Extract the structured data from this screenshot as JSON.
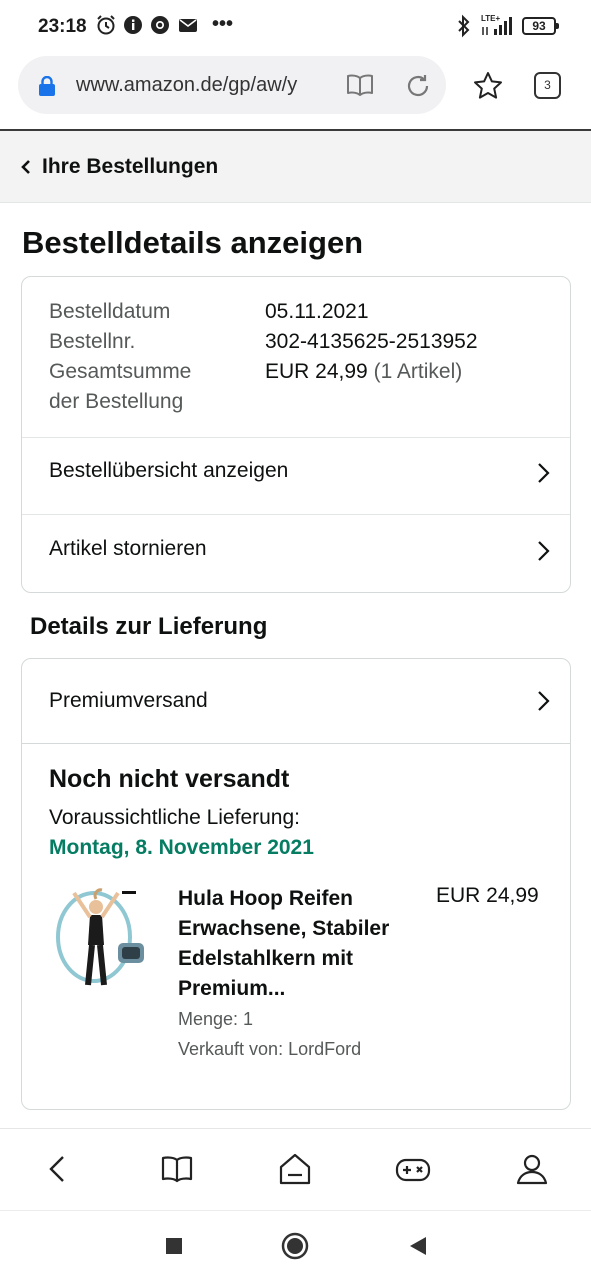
{
  "status_bar": {
    "time": "23:18",
    "more": "•••",
    "network": "LTE+",
    "battery": "93"
  },
  "browser": {
    "url": "www.amazon.de/gp/aw/y",
    "tab_count": "3"
  },
  "header": {
    "back_label": "Ihre Bestellungen"
  },
  "page": {
    "title": "Bestelldetails anzeigen"
  },
  "order_summary": {
    "date_label": "Bestelldatum",
    "date_value": "05.11.2021",
    "number_label": "Bestellnr.",
    "number_value": "302-4135625-2513952",
    "total_label_line1": "Gesamtsumme",
    "total_label_line2": "der Bestellung",
    "total_value": "EUR 24,99",
    "total_items": "(1 Artikel)",
    "links": [
      {
        "label": "Bestellübersicht anzeigen"
      },
      {
        "label": "Artikel stornieren"
      }
    ]
  },
  "delivery": {
    "section_title": "Details zur Lieferung",
    "shipping_method": "Premiumversand",
    "status": "Noch nicht versandt",
    "expected_label": "Voraussichtliche Lieferung:",
    "expected_date": "Montag, 8. November 2021",
    "accent_color": "#067d62"
  },
  "product": {
    "title_lines": [
      "Hula Hoop Reifen",
      "Erwachsene, Stabiler",
      "Edelstahlkern mit",
      "Premium..."
    ],
    "price": "EUR 24,99",
    "quantity": "Menge: 1",
    "seller": "Verkauft von: LordFord",
    "image_icon": "product-photo"
  },
  "bottom_nav": {
    "items": [
      "back-icon",
      "book-icon",
      "home-icon",
      "gamepad-icon",
      "profile-icon"
    ]
  },
  "system_nav": {
    "items": [
      "recents-square-icon",
      "home-circle-icon",
      "back-triangle-icon"
    ]
  }
}
